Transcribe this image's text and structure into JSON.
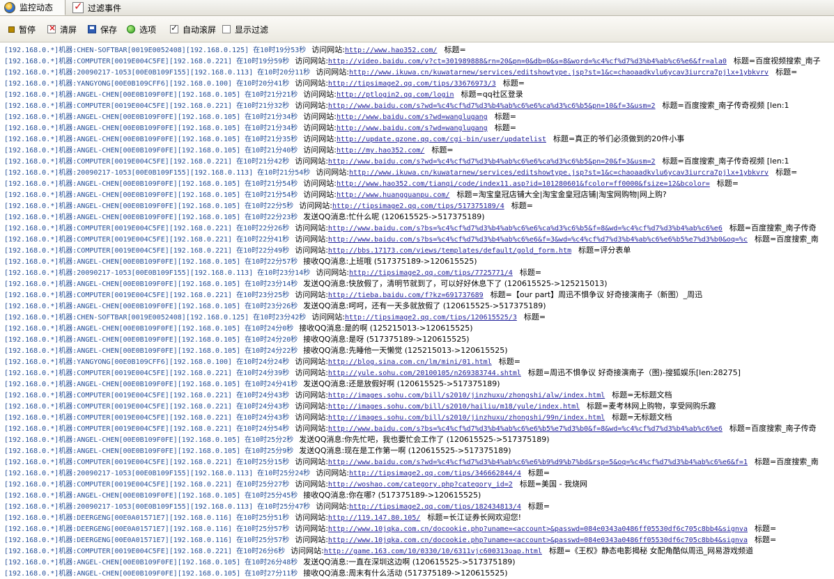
{
  "tabs": [
    {
      "label": "监控动态",
      "icon": "globe-icon"
    },
    {
      "label": "过滤事件",
      "icon": "checklist-icon"
    }
  ],
  "toolbar": {
    "pause": "暂停",
    "clear": "清屏",
    "save": "保存",
    "options": "选项",
    "autoscroll": "自动滚屏",
    "autoscroll_checked": true,
    "showfilter": "显示过滤",
    "showfilter_checked": false
  },
  "log": [
    {
      "src": "[192.168.0.*]机器:CHEN-SOFTBAR[0019E0052408][192.168.0.125] 在10时19分53秒",
      "act": "访问网站:",
      "url": "http://www.hao352.com/",
      "title": "标题="
    },
    {
      "src": "[192.168.0.*]机器:COMPUTER[0019E004C5FE][192.168.0.221] 在10时19分59秒",
      "act": "访问网站:",
      "url": "http://video.baidu.com/v?ct=301989888&rn=20&pn=0&db=0&s=8&word=%c4%cf%d7%d3%b4%ab%c6%e6&fr=ala0",
      "title": "标题=百度视频搜索_南子"
    },
    {
      "src": "[192.168.0.*]机器:20090217-1053[00E0B109F155][192.168.0.113] 在10时20分11秒",
      "act": "访问网站:",
      "url": "http://www.ikuwa.cn/kuwatarnew/services/editshowtype.jsp?st=1&c=chaoaadkvlu6ycav3iurcra7pjlx+1ybkvrv",
      "title": "标题="
    },
    {
      "src": "[192.168.0.*]机器:YANGYONG[00E0B109CFF6][192.168.0.100] 在10时20分41秒",
      "act": "访问网站:",
      "url": "http://tipsimage2.qq.com/tips/33676973/3",
      "title": "标题="
    },
    {
      "src": "[192.168.0.*]机器:ANGEL-CHEN[00E0B109F0FE][192.168.0.105] 在10时21分21秒",
      "act": "访问网站:",
      "url": "http://ptlogin2.qq.com/login",
      "title": "标题=qq社区登录"
    },
    {
      "src": "[192.168.0.*]机器:COMPUTER[0019E004C5FE][192.168.0.221] 在10时21分32秒",
      "act": "访问网站:",
      "url": "http://www.baidu.com/s?wd=%c4%cf%d7%d3%b4%ab%c6%e6%ca%d3%c6%b5&pn=10&f=3&usm=2",
      "title": "标题=百度搜索_南子传奇视频      [len:1"
    },
    {
      "src": "[192.168.0.*]机器:ANGEL-CHEN[00E0B109F0FE][192.168.0.105] 在10时21分34秒",
      "act": "访问网站:",
      "url": "http://www.baidu.com/s?wd=wanglugang",
      "title": "标题="
    },
    {
      "src": "[192.168.0.*]机器:ANGEL-CHEN[00E0B109F0FE][192.168.0.105] 在10时21分34秒",
      "act": "访问网站:",
      "url": "http://www.baidu.com/s?wd=wanglugang",
      "title": "标题="
    },
    {
      "src": "[192.168.0.*]机器:ANGEL-CHEN[00E0B109F0FE][192.168.0.105] 在10时21分35秒",
      "act": "访问网站:",
      "url": "http://update.qzone.qq.com/cgi-bin/user/updatelist",
      "title": "标题=真正的爷们必须做到的20件小事"
    },
    {
      "src": "[192.168.0.*]机器:ANGEL-CHEN[00E0B109F0FE][192.168.0.105] 在10时21分40秒",
      "act": "访问网站:",
      "url": "http://my.hao352.com/",
      "title": "标题="
    },
    {
      "src": "[192.168.0.*]机器:COMPUTER[0019E004C5FE][192.168.0.221] 在10时21分42秒",
      "act": "访问网站:",
      "url": "http://www.baidu.com/s?wd=%c4%cf%d7%d3%b4%ab%c6%e6%ca%d3%c6%b5&pn=20&f=3&usm=2",
      "title": "标题=百度搜索_南子传奇视频      [len:1"
    },
    {
      "src": "[192.168.0.*]机器:20090217-1053[00E0B109F155][192.168.0.113] 在10时21分54秒",
      "act": "访问网站:",
      "url": "http://www.ikuwa.cn/kuwatarnew/services/editshowtype.jsp?st=1&c=chaoaadkvlu6ycav3iurcra7pjlx+1ybkvrv",
      "title": "标题="
    },
    {
      "src": "[192.168.0.*]机器:ANGEL-CHEN[00E0B109F0FE][192.168.0.105] 在10时21分54秒",
      "act": "访问网站:",
      "url": "http://www.hao352.com/tianqi/code/index11.asp?id=101280601&fcolor=ff0000&fsize=12&bcolor=",
      "title": "标题="
    },
    {
      "src": "[192.168.0.*]机器:ANGEL-CHEN[00E0B109F0FE][192.168.0.105] 在10时21分54秒",
      "act": "访问网站:",
      "url": "http://www.huangguanpu.com/",
      "title": "标题=淘宝皇冠店铺大全|淘宝金皇冠店铺|淘宝网购物|网上购?"
    },
    {
      "src": "[192.168.0.*]机器:ANGEL-CHEN[00E0B109F0FE][192.168.0.105] 在10时22分5秒",
      "act": "访问网站:",
      "url": "http://tipsimage2.qq.com/tips/517375189/4",
      "title": "标题="
    },
    {
      "src": "[192.168.0.*]机器:ANGEL-CHEN[00E0B109F0FE][192.168.0.105] 在10时22分23秒",
      "act": "发送QQ消息:",
      "msg": "忙什么呢  (120615525->517375189)"
    },
    {
      "src": "[192.168.0.*]机器:COMPUTER[0019E004C5FE][192.168.0.221] 在10时22分26秒",
      "act": "访问网站:",
      "url": "http://www.baidu.com/s?bs=%c4%cf%d7%d3%b4%ab%c6%e6%ca%d3%c6%b5&f=8&wd=%c4%cf%d7%d3%b4%ab%c6%e6",
      "title": "标题=百度搜索_南子传奇"
    },
    {
      "src": "[192.168.0.*]机器:COMPUTER[0019E004C5FE][192.168.0.221] 在10时22分41秒",
      "act": "访问网站:",
      "url": "http://www.baidu.com/s?bs=%c4%cf%d7%d3%b4%ab%c6%e6&f=3&wd=%c4%cf%d7%d3%b4%ab%c6%e6%b5%e7%d3%b0&oq=%c",
      "title": "标题=百度搜索_南"
    },
    {
      "src": "[192.168.0.*]机器:COMPUTER[0019E004C5FE][192.168.0.221] 在10时22分49秒",
      "act": "访问网站:",
      "url": "http://bbs.17173.com/views/templates/default/gold_form.htm",
      "title": "标题=评分表单"
    },
    {
      "src": "[192.168.0.*]机器:ANGEL-CHEN[00E0B109F0FE][192.168.0.105] 在10时22分57秒",
      "act": "接收QQ消息:",
      "msg": "上班哦  (517375189->120615525)"
    },
    {
      "src": "[192.168.0.*]机器:20090217-1053[00E0B109F155][192.168.0.113] 在10时23分14秒",
      "act": "访问网站:",
      "url": "http://tipsimage2.qq.com/tips/7725771/4",
      "title": "标题="
    },
    {
      "src": "[192.168.0.*]机器:ANGEL-CHEN[00E0B109F0FE][192.168.0.105] 在10时23分14秒",
      "act": "发送QQ消息:",
      "msg": "快放假了，清明节就到了，可以好好休息下了  (120615525->125215013)"
    },
    {
      "src": "[192.168.0.*]机器:COMPUTER[0019E004C5FE][192.168.0.221] 在10时23分25秒",
      "act": "访问网站:",
      "url": "http://tieba.baidu.com/f?kz=691737689",
      "title": "标题=【our part】周迅不惧争议 好奇接演南子（新图）_周迅"
    },
    {
      "src": "[192.168.0.*]机器:ANGEL-CHEN[00E0B109F0FE][192.168.0.105] 在10时23分26秒",
      "act": "发送QQ消息:",
      "msg": "呵呵，还有一天多就放假了  (120615525->517375189)"
    },
    {
      "src": "[192.168.0.*]机器:CHEN-SOFTBAR[0019E0052408][192.168.0.125] 在10时23分42秒",
      "act": "访问网站:",
      "url": "http://tipsimage2.qq.com/tips/120615525/3",
      "title": "标题="
    },
    {
      "src": "[192.168.0.*]机器:ANGEL-CHEN[00E0B109F0FE][192.168.0.105] 在10时24分0秒",
      "act": "接收QQ消息:",
      "msg": "是的啊  (125215013->120615525)"
    },
    {
      "src": "[192.168.0.*]机器:ANGEL-CHEN[00E0B109F0FE][192.168.0.105] 在10时24分20秒",
      "act": "接收QQ消息:",
      "msg": "是呀  (517375189->120615525)"
    },
    {
      "src": "[192.168.0.*]机器:ANGEL-CHEN[00E0B109F0FE][192.168.0.105] 在10时24分22秒",
      "act": "接收QQ消息:",
      "msg": "先睡他一天懒觉  (125215013->120615525)"
    },
    {
      "src": "[192.168.0.*]机器:YANGYONG[00E0B109CFF6][192.168.0.100] 在10时24分24秒",
      "act": "访问网站:",
      "url": "http://blog.sina.com.cn/lm/mini/01.html",
      "title": "标题="
    },
    {
      "src": "[192.168.0.*]机器:COMPUTER[0019E004C5FE][192.168.0.221] 在10时24分39秒",
      "act": "访问网站:",
      "url": "http://yule.sohu.com/20100105/n269383744.shtml",
      "title": "标题=周迅不惧争议 好奇接演南子（图)-搜狐娱乐[len:28275]"
    },
    {
      "src": "[192.168.0.*]机器:ANGEL-CHEN[00E0B109F0FE][192.168.0.105] 在10时24分41秒",
      "act": "发送QQ消息:",
      "msg": "还是放假好啊  (120615525->517375189)"
    },
    {
      "src": "[192.168.0.*]机器:COMPUTER[0019E004C5FE][192.168.0.221] 在10时24分43秒",
      "act": "访问网站:",
      "url": "http://images.sohu.com/bill/s2010/jinzhuxu/zhongshi/alw/index.html",
      "title": "标题=无标题文档"
    },
    {
      "src": "[192.168.0.*]机器:COMPUTER[0019E004C5FE][192.168.0.221] 在10时24分43秒",
      "act": "访问网站:",
      "url": "http://images.sohu.com/bill/s2010/hailiu/m18/yule/index.html",
      "title": "标题=麦考林网上购物，享受网购乐趣"
    },
    {
      "src": "[192.168.0.*]机器:COMPUTER[0019E004C5FE][192.168.0.221] 在10时24分43秒",
      "act": "访问网站:",
      "url": "http://images.sohu.com/bill/s2010/jinzhuxu/zhongshi/99n/index.html",
      "title": "标题=无标题文档"
    },
    {
      "src": "[192.168.0.*]机器:COMPUTER[0019E004C5FE][192.168.0.221] 在10时24分54秒",
      "act": "访问网站:",
      "url": "http://www.baidu.com/s?bs=%c4%cf%d7%d3%b4%ab%c6%e6%b5%e7%d3%b0&f=8&wd=%c4%cf%d7%d3%b4%ab%c6%e6",
      "title": "标题=百度搜索_南子传奇"
    },
    {
      "src": "[192.168.0.*]机器:ANGEL-CHEN[00E0B109F0FE][192.168.0.105] 在10时25分2秒",
      "act": "发送QQ消息:",
      "msg": "你先忙吧，我也要忙会工作了  (120615525->517375189)"
    },
    {
      "src": "[192.168.0.*]机器:ANGEL-CHEN[00E0B109F0FE][192.168.0.105] 在10时25分9秒",
      "act": "发送QQ消息:",
      "msg": "现在是工作第一啊  (120615525->517375189)"
    },
    {
      "src": "[192.168.0.*]机器:COMPUTER[0019E004C5FE][192.168.0.221] 在10时25分15秒",
      "act": "访问网站:",
      "url": "http://www.baidu.com/s?wd=%c4%cf%d7%d3%b4%ab%c6%e6%b9%d9%b7%bd&rsp=5&oq=%c4%cf%d7%d3%b4%ab%c6%e6&f=1",
      "title": "标题=百度搜索_南"
    },
    {
      "src": "[192.168.0.*]机器:20090217-1053[00E0B109F155][192.168.0.113] 在10时25分24秒",
      "act": "访问网站:",
      "url": "http://tipsimage2.qq.com/tips/346662844/4",
      "title": "标题="
    },
    {
      "src": "[192.168.0.*]机器:COMPUTER[0019E004C5FE][192.168.0.221] 在10时25分27秒",
      "act": "访问网站:",
      "url": "http://woshao.com/category.php?category_id=2",
      "title": "标题=美国 - 我烧网"
    },
    {
      "src": "[192.168.0.*]机器:ANGEL-CHEN[00E0B109F0FE][192.168.0.105] 在10时25分45秒",
      "act": "接收QQ消息:",
      "msg": "你在哪?  (517375189->120615525)"
    },
    {
      "src": "[192.168.0.*]机器:20090217-1053[00E0B109F155][192.168.0.113] 在10时25分47秒",
      "act": "访问网站:",
      "url": "http://tipsimage2.qq.com/tips/182434813/4",
      "title": "标题="
    },
    {
      "src": "[192.168.0.*]机器:DEERGENG[00E0A01571E7][192.168.0.116] 在10时25分51秒",
      "act": "访问网站:",
      "url": "http://119.147.80.105/",
      "title": "标题=长江证券长网欢迎您!"
    },
    {
      "src": "[192.168.0.*]机器:DEERGENG[00E0A01571E7][192.168.0.116] 在10时25分57秒",
      "act": "访问网站:",
      "url": "http://www.10jqka.com.cn/docookie.php?uname=<account>&passwd=084e0343a0486ff05530df6c705c8bb4&signva",
      "title": "标题="
    },
    {
      "src": "[192.168.0.*]机器:DEERGENG[00E0A01571E7][192.168.0.116] 在10时25分57秒",
      "act": "访问网站:",
      "url": "http://www.10jqka.com.cn/docookie.php?uname=<account>&passwd=084e0343a0486ff05530df6c705c8bb4&signva",
      "title": "标题="
    },
    {
      "src": "[192.168.0.*]机器:COMPUTER[0019E004C5FE][192.168.0.221] 在10时26分6秒",
      "act": "访问网站:",
      "url": "http://game.163.com/10/0330/10/6311vjc600313oap.html",
      "title": "标题=《王权》静态电影揭秘 女配角酷似周迅_网易游戏频道"
    },
    {
      "src": "[192.168.0.*]机器:ANGEL-CHEN[00E0B109F0FE][192.168.0.105] 在10时26分48秒",
      "act": "发送QQ消息:",
      "msg": "一直在深圳这边啊  (120615525->517375189)"
    },
    {
      "src": "[192.168.0.*]机器:ANGEL-CHEN[00E0B109F0FE][192.168.0.105] 在10时27分11秒",
      "act": "接收QQ消息:",
      "msg": "周末有什么活动  (517375189->120615525)"
    }
  ]
}
